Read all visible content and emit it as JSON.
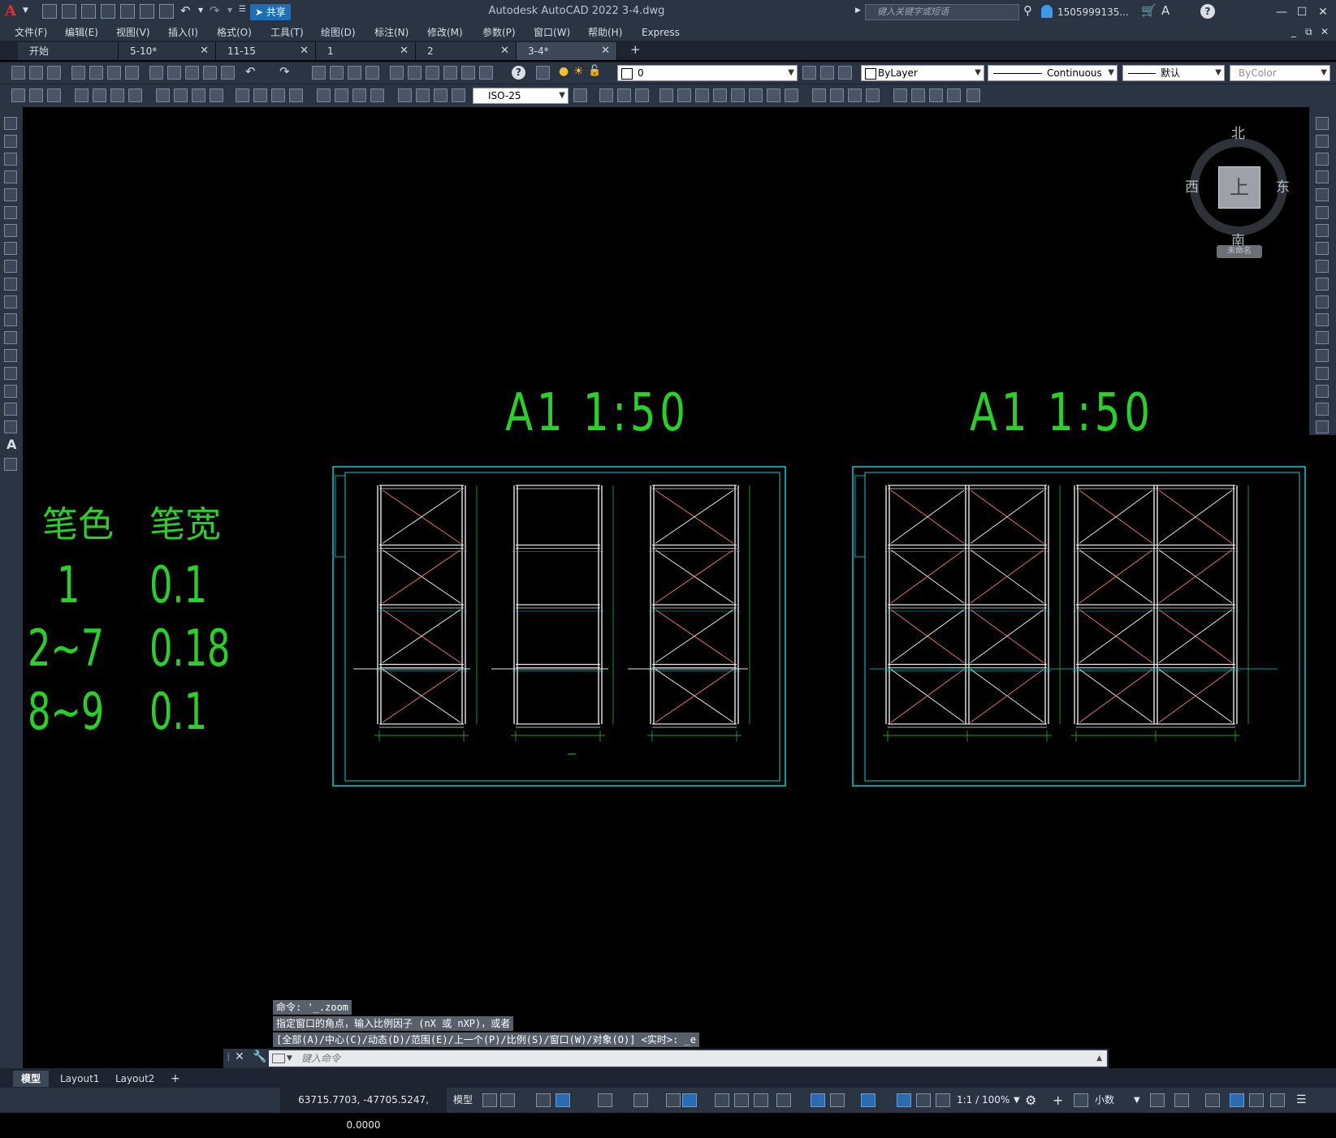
{
  "app": {
    "logo": "A",
    "share_label": "共享",
    "title": "Autodesk AutoCAD 2022    3-4.dwg",
    "search_placeholder": "键入关键字或短语",
    "user_name": "1505999135...",
    "help_label": "?"
  },
  "menu": [
    "文件(F)",
    "编辑(E)",
    "视图(V)",
    "插入(I)",
    "格式(O)",
    "工具(T)",
    "绘图(D)",
    "标注(N)",
    "修改(M)",
    "参数(P)",
    "窗口(W)",
    "帮助(H)",
    "Express"
  ],
  "tabs": [
    {
      "label": "开始",
      "active": false
    },
    {
      "label": "5-10*",
      "active": false
    },
    {
      "label": "11-15",
      "active": false
    },
    {
      "label": "1",
      "active": false
    },
    {
      "label": "2",
      "active": false
    },
    {
      "label": "3-4*",
      "active": true
    }
  ],
  "tab_add": "+",
  "properties": {
    "layer_value": "0",
    "color_value": "ByLayer",
    "linetype_value": "Continuous",
    "lineweight_value": "默认",
    "plotstyle_value": "ByColor",
    "dimstyle_value": "ISO-25"
  },
  "drawing": {
    "sheet_labels": [
      "A1  1:50",
      "A1  1:50"
    ],
    "pen_table": {
      "headers": [
        "笔色",
        "笔宽"
      ],
      "rows": [
        [
          "1",
          "0.1"
        ],
        [
          "2~7",
          "0.18"
        ],
        [
          "8~9",
          "0.1"
        ]
      ]
    }
  },
  "viewcube": {
    "north": "北",
    "south": "南",
    "east": "东",
    "west": "西",
    "face": "上",
    "wcs": "未命名"
  },
  "command_history": [
    "命令: '_.zoom",
    "指定窗口的角点，输入比例因子 (nX 或 nXP)，或者",
    "[全部(A)/中心(C)/动态(D)/范围(E)/上一个(P)/比例(S)/窗口(W)/对象(O)] <实时>: _e"
  ],
  "command_placeholder": "键入命令",
  "layout_tabs": [
    {
      "label": "模型",
      "active": true
    },
    {
      "label": "Layout1",
      "active": false
    },
    {
      "label": "Layout2",
      "active": false
    }
  ],
  "layout_add": "+",
  "status": {
    "coords": "63715.7703, -47705.5247, 0.0000",
    "model": "模型",
    "scale": "1:1 / 100%",
    "units": "小数"
  },
  "colors": {
    "drawing_green": "#27d227",
    "sheet_cyan": "#00d2d2",
    "ui_dark": "#2b3442",
    "tab_dark": "#1e2530"
  }
}
